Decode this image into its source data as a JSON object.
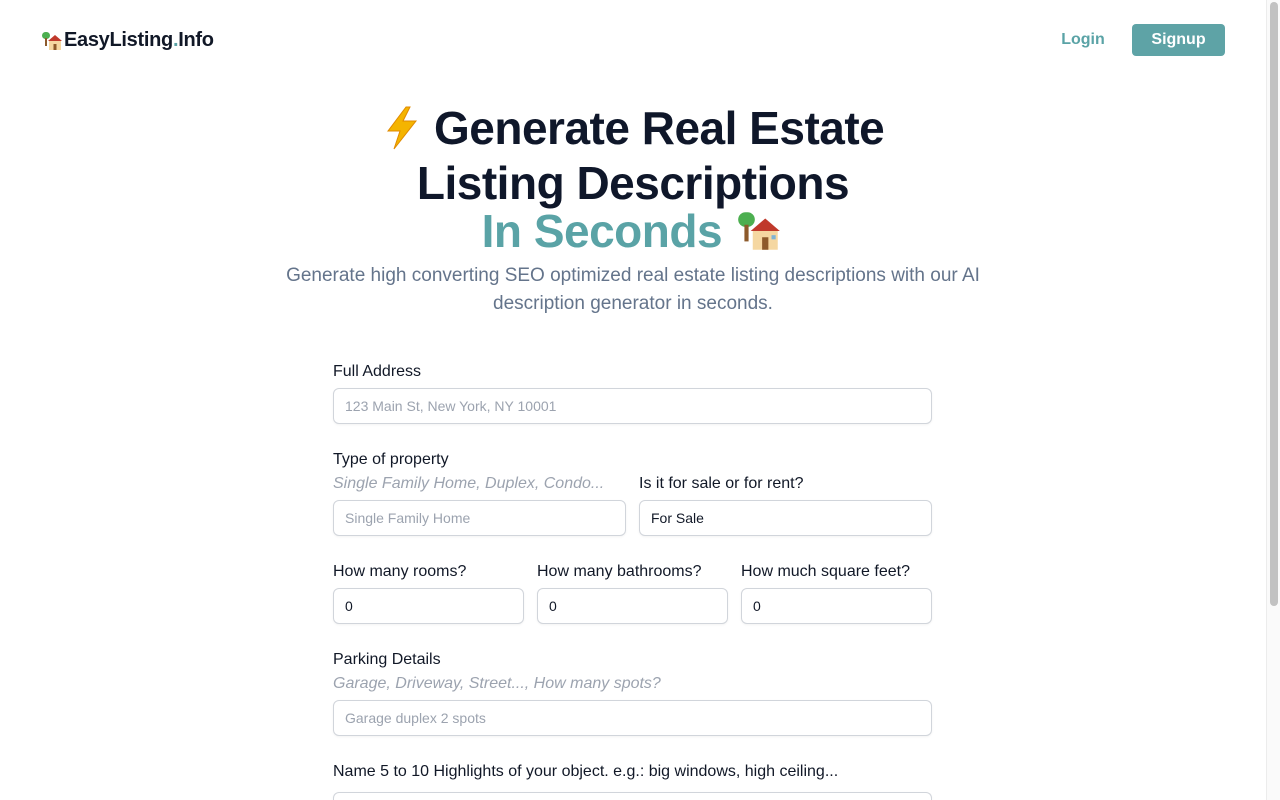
{
  "header": {
    "logo_main": "EasyListing",
    "logo_dot": ".",
    "logo_suffix": "Info",
    "login_label": "Login",
    "signup_label": "Signup"
  },
  "hero": {
    "line1": "Generate Real Estate",
    "line2": "Listing Descriptions",
    "line3": "In Seconds",
    "subtitle": "Generate high converting SEO optimized real estate listing descriptions with our AI description generator in seconds."
  },
  "form": {
    "address": {
      "label": "Full Address",
      "placeholder": "123 Main St, New York, NY 10001"
    },
    "property_type": {
      "label": "Type of property",
      "hint": "Single Family Home, Duplex, Condo...",
      "placeholder": "Single Family Home"
    },
    "sale_rent": {
      "label": "Is it for sale or for rent?",
      "value": "For Sale"
    },
    "rooms": {
      "label": "How many rooms?",
      "value": "0"
    },
    "bathrooms": {
      "label": "How many bathrooms?",
      "value": "0"
    },
    "square_feet": {
      "label": "How much square feet?",
      "value": "0"
    },
    "parking": {
      "label": "Parking Details",
      "hint": "Garage, Driveway, Street..., How many spots?",
      "placeholder": "Garage duplex 2 spots"
    },
    "highlights": {
      "label": "Name 5 to 10 Highlights of your object. e.g.: big windows, high ceiling..."
    }
  },
  "colors": {
    "accent": "#5ea3a6",
    "title": "#0f172a",
    "muted": "#64748b"
  },
  "icons": {
    "logo": "house-tree-icon",
    "title_lead": "lightning-icon",
    "title_trail": "house-tree-icon"
  }
}
